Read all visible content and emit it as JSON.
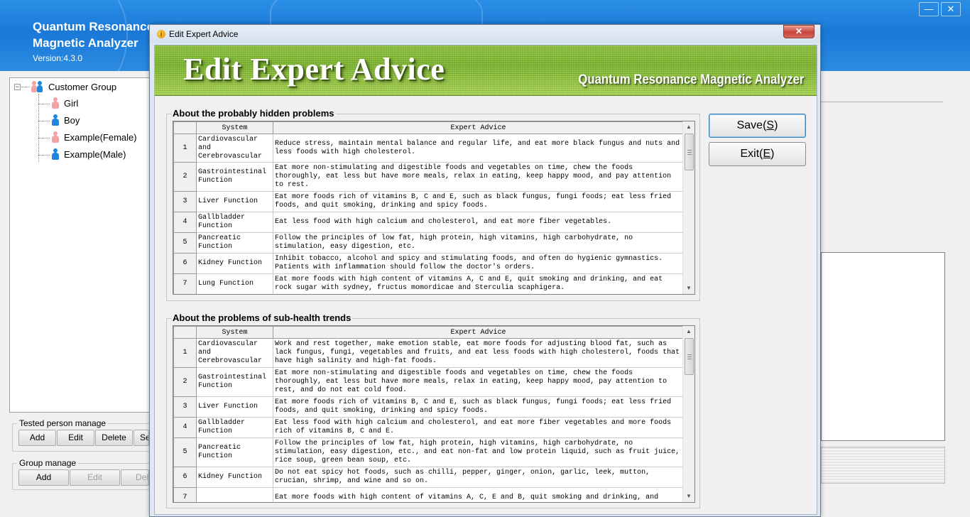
{
  "app": {
    "title_line1": "Quantum Resonance",
    "title_line2": "Magnetic Analyzer",
    "version": "Version:4.3.0",
    "minimize_glyph": "—",
    "close_glyph": "✕"
  },
  "tree": {
    "root": {
      "label": "Customer Group",
      "expander": "−"
    },
    "children": [
      {
        "label": "Girl",
        "icon": "female-person-icon",
        "color": "#f2a3a3"
      },
      {
        "label": "Boy",
        "icon": "male-person-icon",
        "color": "#1f86e0"
      },
      {
        "label": "Example(Female)",
        "icon": "female-person-icon",
        "color": "#f2a3a3"
      },
      {
        "label": "Example(Male)",
        "icon": "male-person-icon",
        "color": "#1f86e0"
      }
    ]
  },
  "tested_person_manage": {
    "legend": "Tested person manage",
    "buttons": [
      "Add",
      "Edit",
      "Delete",
      "Se"
    ]
  },
  "group_manage": {
    "legend": "Group manage",
    "buttons": [
      "Add",
      "Edit",
      "Dele"
    ]
  },
  "dialog": {
    "title": "Edit Expert Advice",
    "close_glyph": "✕",
    "banner_title": "Edit Expert Advice",
    "banner_subtitle": "Quantum Resonance Magnetic Analyzer",
    "save_label": "Save(",
    "save_key": "S",
    "save_end": ")",
    "exit_label": "Exit(",
    "exit_key": "E",
    "exit_end": ")"
  },
  "hidden_problems": {
    "legend": "About the probably hidden problems",
    "columns": [
      "System",
      "Expert Advice"
    ],
    "rows": [
      {
        "num": "1",
        "system": "Cardiovascular and Cerebrovascular",
        "advice": "Reduce stress, maintain mental balance and regular life, and eat more black fungus and nuts and less foods with high cholesterol."
      },
      {
        "num": "2",
        "system": "Gastrointestinal Function",
        "advice": "Eat more non-stimulating and digestible foods and vegetables on time, chew the foods thoroughly, eat less but have more meals, relax in eating, keep happy mood, and pay attention to rest."
      },
      {
        "num": "3",
        "system": "Liver Function",
        "advice": "Eat more foods rich of vitamins B, C and E, such as black fungus, fungi foods; eat less fried foods, and quit smoking, drinking and spicy foods."
      },
      {
        "num": "4",
        "system": "Gallbladder Function",
        "advice": "Eat less food with high calcium and cholesterol, and eat more fiber vegetables."
      },
      {
        "num": "5",
        "system": "Pancreatic Function",
        "advice": "Follow the principles of low fat, high protein, high vitamins, high carbohydrate, no stimulation, easy digestion, etc."
      },
      {
        "num": "6",
        "system": "Kidney Function",
        "advice": "Inhibit tobacco, alcohol and spicy and stimulating foods, and often do hygienic gymnastics. Patients with inflammation should follow the doctor's orders."
      },
      {
        "num": "7",
        "system": "Lung Function",
        "advice": "Eat more foods with high content of vitamins A, C and E, quit smoking and drinking, and eat rock sugar with sydney, fructus momordicae and Sterculia scaphigera."
      }
    ]
  },
  "subhealth_trends": {
    "legend": "About the problems of sub-health trends",
    "columns": [
      "System",
      "Expert Advice"
    ],
    "rows": [
      {
        "num": "1",
        "system": "Cardiovascular and Cerebrovascular",
        "advice": "Work and rest together, make emotion stable, eat more foods for adjusting blood fat, such as lack fungus, fungi, vegetables and fruits, and eat less foods with high cholesterol, foods that have high salinity and high-fat foods."
      },
      {
        "num": "2",
        "system": "Gastrointestinal Function",
        "advice": "Eat more non-stimulating and digestible foods and vegetables on time, chew the foods thoroughly, eat less but have more meals, relax in eating, keep happy mood, pay attention to rest, and do not eat cold food."
      },
      {
        "num": "3",
        "system": "Liver Function",
        "advice": "Eat more foods rich of vitamins B, C and E, such as black fungus, fungi foods; eat less fried foods, and quit smoking, drinking and spicy foods."
      },
      {
        "num": "4",
        "system": "Gallbladder Function",
        "advice": "Eat less food with high calcium and cholesterol, and eat more fiber vegetables and more foods rich of vitamins B, C and E."
      },
      {
        "num": "5",
        "system": "Pancreatic Function",
        "advice": "Follow the principles of low fat, high protein, high vitamins, high carbohydrate, no stimulation, easy digestion, etc., and eat non-fat and low protein liquid, such as fruit juice, rice soup, green bean soup, etc."
      },
      {
        "num": "6",
        "system": "Kidney Function",
        "advice": "Do not eat spicy hot foods, such as chilli, pepper, ginger, onion, garlic, leek, mutton, crucian, shrimp, and wine and so on."
      },
      {
        "num": "7",
        "system": "",
        "advice": "Eat more foods with high content of vitamins A, C, E and B, quit smoking and drinking, and"
      }
    ]
  }
}
